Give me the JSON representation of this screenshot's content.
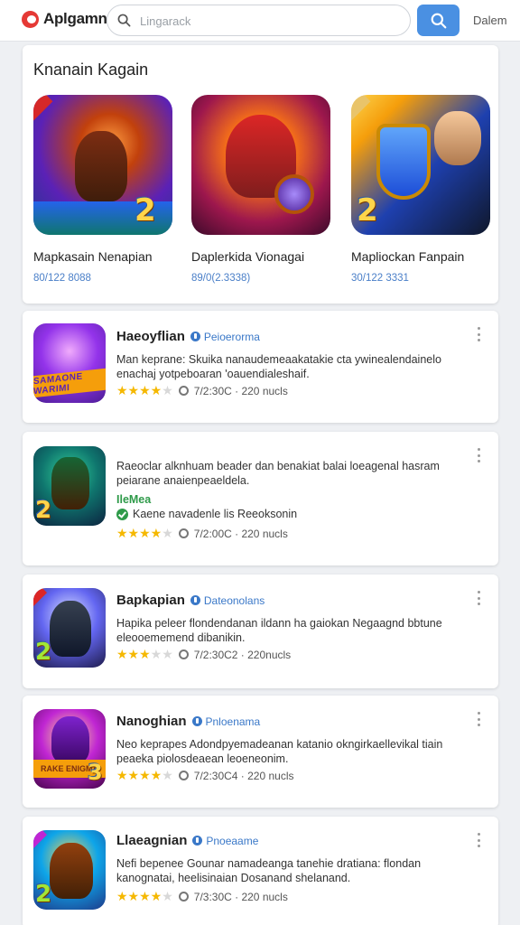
{
  "header": {
    "app_name": "Aplgamn",
    "search_placeholder": "Lingarack",
    "right_link": "Dalem"
  },
  "featured": {
    "title": "Knanain Kagain",
    "items": [
      {
        "title": "Mapkasain Nenapian",
        "meta": "80/122 8088",
        "badge": "2"
      },
      {
        "title": "Daplerkida Vionagai",
        "meta": "89/0(2.3338)",
        "badge": ""
      },
      {
        "title": "Mapliockan Fanpain",
        "meta": "30/122 3331",
        "badge": "2"
      }
    ]
  },
  "list": [
    {
      "title": "Haeoyflian",
      "developer": "Peioerorma",
      "desc": "Man keprane: Skuika nanaudemeaakatakie cta ywinealendainelo enachaj yotpeboaran 'oauendialeshaif.",
      "rating": 4.5,
      "stats": "7/2:30C · 220 nucls",
      "thumb_label": "SAMAONE WARIMI",
      "thumb_tag": ""
    },
    {
      "title": "Raeoclar alk",
      "developer": "",
      "desc": "Raeoclar alknhuam beader dan benakiat balai loeagenal hasram peiarane anaienpeaeldela.",
      "badge": "IleMea",
      "check_text": "Kaene navadenle lis Reeoksonin",
      "rating": 4.5,
      "stats": "7/2:00C · 220 nucls",
      "thumb_label": "",
      "thumb_tag": "2"
    },
    {
      "title": "Bapkapian",
      "developer": "Dateonolans",
      "desc": "Hapika peleer flondendanan ildann ha gaiokan Negaagnd bbtune eleooememend dibanikin.",
      "rating": 3.5,
      "stats": "7/2:30C2 · 220nucls",
      "thumb_label": "",
      "thumb_tag": "2"
    },
    {
      "title": "Nanoghian",
      "developer": "Pnloenama",
      "desc": "Neo keprapes Adondpyemadeanan katanio okngirkaellevikal tiain peaeka piolosdeaean leoeneonim.",
      "rating": 4.5,
      "stats": "7/2:30C4 · 220 nucls",
      "thumb_label": "RAKE ENIGMA",
      "thumb_tag": "3"
    },
    {
      "title": "Llaeagnian",
      "developer": "Pnoeaame",
      "desc": "Nefi bepenee Gounar namadeanga tanehie dratiana: flondan kanognatai, heelisinaian Dosanand shelanand.",
      "rating": 4.0,
      "stats": "7/3:30C · 220 nucls",
      "thumb_label": "",
      "thumb_tag": "2"
    }
  ],
  "colors": {
    "accent": "#4a90e2",
    "star": "#f5b800",
    "link": "#3a78c8",
    "verified": "#2e9a49",
    "brand": "#e53935"
  }
}
